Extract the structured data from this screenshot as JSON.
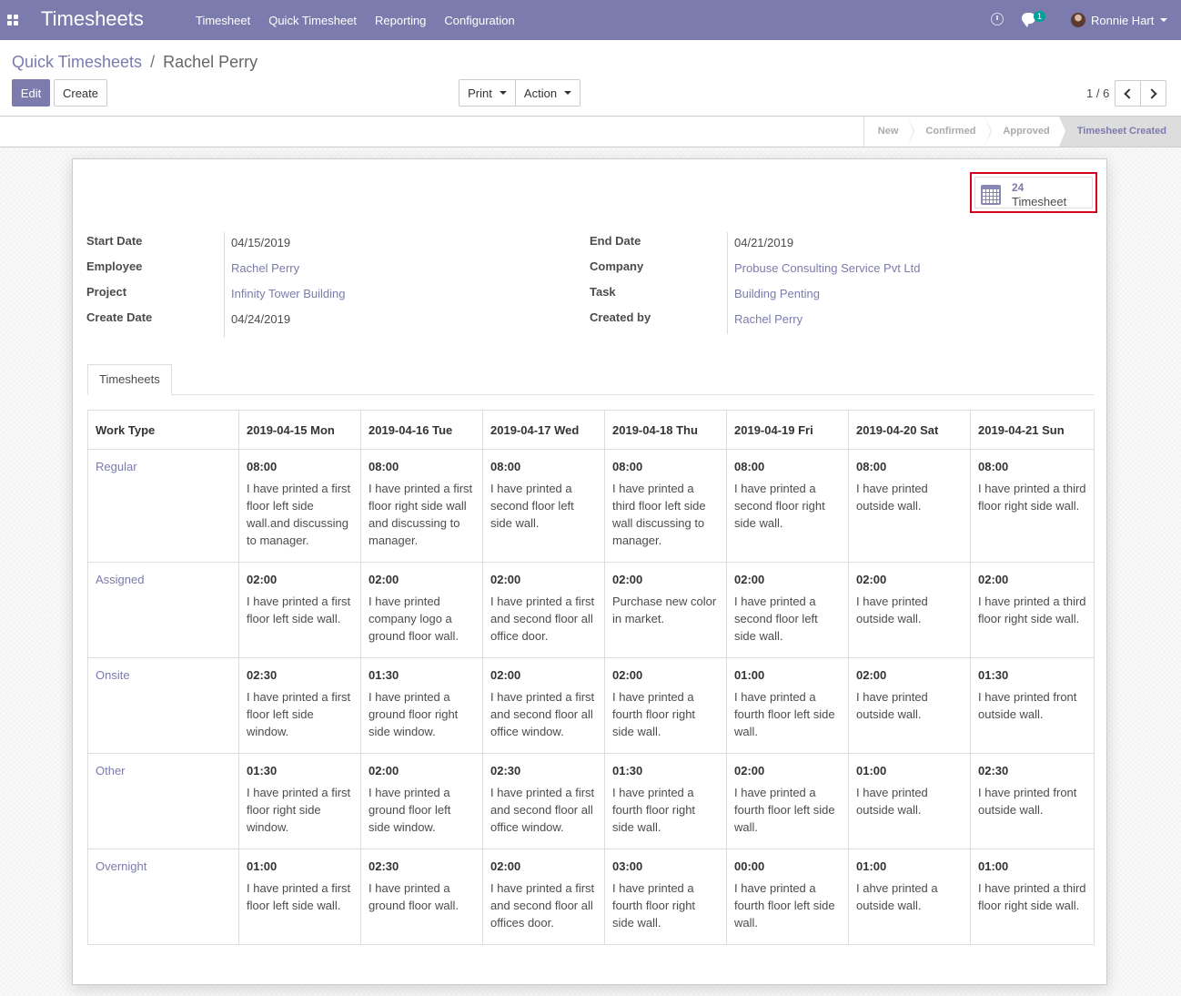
{
  "app": {
    "brand": "Timesheets",
    "menu": [
      "Timesheet",
      "Quick Timesheet",
      "Reporting",
      "Configuration"
    ],
    "chat_count": "1",
    "user_name": "Ronnie Hart"
  },
  "breadcrumb": {
    "parent": "Quick Timesheets",
    "separator": "/",
    "current": "Rachel Perry"
  },
  "toolbar": {
    "edit": "Edit",
    "create": "Create",
    "print": "Print",
    "action": "Action",
    "pager": "1 / 6"
  },
  "statusbar": {
    "stages": [
      "New",
      "Confirmed",
      "Approved",
      "Timesheet Created"
    ],
    "active": "Timesheet Created"
  },
  "smart_button": {
    "count": "24",
    "label": "Timesheet"
  },
  "fields": {
    "start_date": {
      "label": "Start Date",
      "value": "04/15/2019"
    },
    "employee": {
      "label": "Employee",
      "value": "Rachel Perry"
    },
    "project": {
      "label": "Project",
      "value": "Infinity Tower Building"
    },
    "create_date": {
      "label": "Create Date",
      "value": "04/24/2019"
    },
    "end_date": {
      "label": "End Date",
      "value": "04/21/2019"
    },
    "company": {
      "label": "Company",
      "value": "Probuse Consulting Service Pvt Ltd"
    },
    "task": {
      "label": "Task",
      "value": "Building Penting"
    },
    "created_by": {
      "label": "Created by",
      "value": "Rachel Perry"
    }
  },
  "tab": "Timesheets",
  "grid": {
    "headers": [
      "Work Type",
      "2019-04-15 Mon",
      "2019-04-16 Tue",
      "2019-04-17 Wed",
      "2019-04-18 Thu",
      "2019-04-19 Fri",
      "2019-04-20 Sat",
      "2019-04-21 Sun"
    ],
    "rows": [
      {
        "type": "Regular",
        "cells": [
          {
            "hours": "08:00",
            "desc": "I have printed a first floor left side wall.and discussing to manager."
          },
          {
            "hours": "08:00",
            "desc": "I have printed a first floor right side wall and discussing to manager."
          },
          {
            "hours": "08:00",
            "desc": "I have printed a second floor left side wall."
          },
          {
            "hours": "08:00",
            "desc": "I have printed a third floor left side wall discussing to manager."
          },
          {
            "hours": "08:00",
            "desc": "I have printed a second floor right side wall."
          },
          {
            "hours": "08:00",
            "desc": "I have printed outside wall."
          },
          {
            "hours": "08:00",
            "desc": "I have printed a third floor right side wall."
          }
        ]
      },
      {
        "type": "Assigned",
        "cells": [
          {
            "hours": "02:00",
            "desc": "I have printed a first floor left side wall."
          },
          {
            "hours": "02:00",
            "desc": "I have printed company logo a ground floor wall."
          },
          {
            "hours": "02:00",
            "desc": "I have printed a first and second floor all office door."
          },
          {
            "hours": "02:00",
            "desc": "Purchase new color in market."
          },
          {
            "hours": "02:00",
            "desc": "I have printed a second floor left side wall."
          },
          {
            "hours": "02:00",
            "desc": "I have printed outside wall."
          },
          {
            "hours": "02:00",
            "desc": "I have printed a third floor right side wall."
          }
        ]
      },
      {
        "type": "Onsite",
        "cells": [
          {
            "hours": "02:30",
            "desc": "I have printed a first floor left side window."
          },
          {
            "hours": "01:30",
            "desc": "I have printed a ground floor right side window."
          },
          {
            "hours": "02:00",
            "desc": "I have printed a first and second floor all office window."
          },
          {
            "hours": "02:00",
            "desc": "I have printed a fourth floor right side wall."
          },
          {
            "hours": "01:00",
            "desc": "I have printed a fourth floor left side wall."
          },
          {
            "hours": "02:00",
            "desc": "I have printed outside wall."
          },
          {
            "hours": "01:30",
            "desc": "I have printed front outside wall."
          }
        ]
      },
      {
        "type": "Other",
        "cells": [
          {
            "hours": "01:30",
            "desc": "I have printed a first floor right side window."
          },
          {
            "hours": "02:00",
            "desc": "I have printed a ground floor left side window."
          },
          {
            "hours": "02:30",
            "desc": "I have printed a first and second floor all office window."
          },
          {
            "hours": "01:30",
            "desc": "I have printed a fourth floor right side wall."
          },
          {
            "hours": "02:00",
            "desc": "I have printed a fourth floor left side wall."
          },
          {
            "hours": "01:00",
            "desc": "I have printed outside wall."
          },
          {
            "hours": "02:30",
            "desc": "I have printed front outside wall."
          }
        ]
      },
      {
        "type": "Overnight",
        "cells": [
          {
            "hours": "01:00",
            "desc": "I have printed a first floor left side wall."
          },
          {
            "hours": "02:30",
            "desc": "I have printed a ground floor wall."
          },
          {
            "hours": "02:00",
            "desc": "I have printed a first and second floor all offices door."
          },
          {
            "hours": "03:00",
            "desc": "I have printed a fourth floor right side wall."
          },
          {
            "hours": "00:00",
            "desc": "I have printed a fourth floor left side wall."
          },
          {
            "hours": "01:00",
            "desc": "I ahve printed a outside wall."
          },
          {
            "hours": "01:00",
            "desc": "I have printed a third floor right side wall."
          }
        ]
      }
    ]
  }
}
